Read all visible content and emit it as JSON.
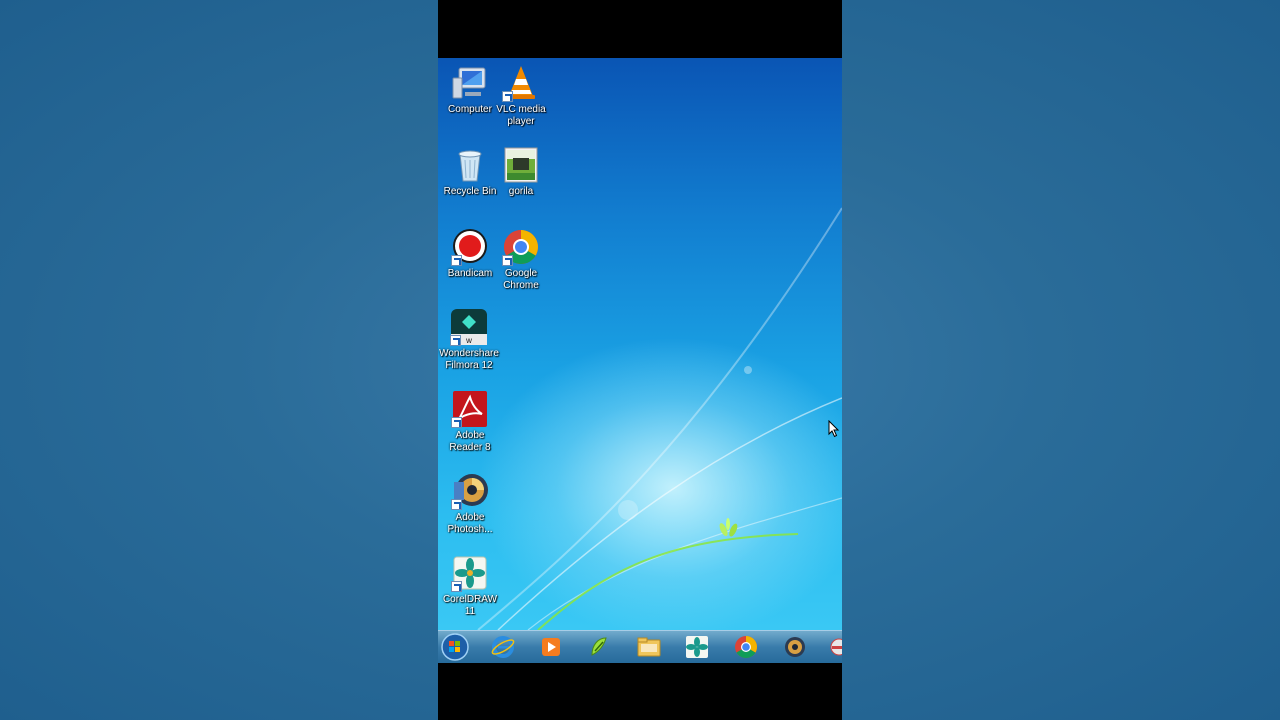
{
  "desktop": {
    "icons": [
      {
        "label": "Computer",
        "icon": "computer-icon"
      },
      {
        "label": "VLC media player",
        "icon": "vlc-icon"
      },
      {
        "label": "Recycle Bin",
        "icon": "recycle-bin-icon"
      },
      {
        "label": "gorila",
        "icon": "image-file-icon"
      },
      {
        "label": "Bandicam",
        "icon": "bandicam-icon"
      },
      {
        "label": "Google Chrome",
        "icon": "chrome-icon"
      },
      {
        "label": "Wondershare Filmora 12",
        "icon": "filmora-icon"
      },
      {
        "label": "Adobe Reader 8",
        "icon": "adobe-reader-icon"
      },
      {
        "label": "Adobe Photosh...",
        "icon": "photoshop-icon"
      },
      {
        "label": "CorelDRAW 11",
        "icon": "coreldraw-icon"
      }
    ]
  },
  "taskbar": {
    "items": [
      {
        "icon": "start-orb-icon"
      },
      {
        "icon": "internet-explorer-icon"
      },
      {
        "icon": "media-player-icon"
      },
      {
        "icon": "corel-app-icon"
      },
      {
        "icon": "file-explorer-icon"
      },
      {
        "icon": "coreldraw-icon"
      },
      {
        "icon": "chrome-icon"
      },
      {
        "icon": "photoshop-icon"
      },
      {
        "icon": "overflow-app-icon"
      }
    ]
  },
  "colors": {
    "desktop_top": "#0a55b4",
    "desktop_bottom": "#3ac8f4",
    "side_background": "#2a6c99",
    "letterbox": "#000000"
  }
}
